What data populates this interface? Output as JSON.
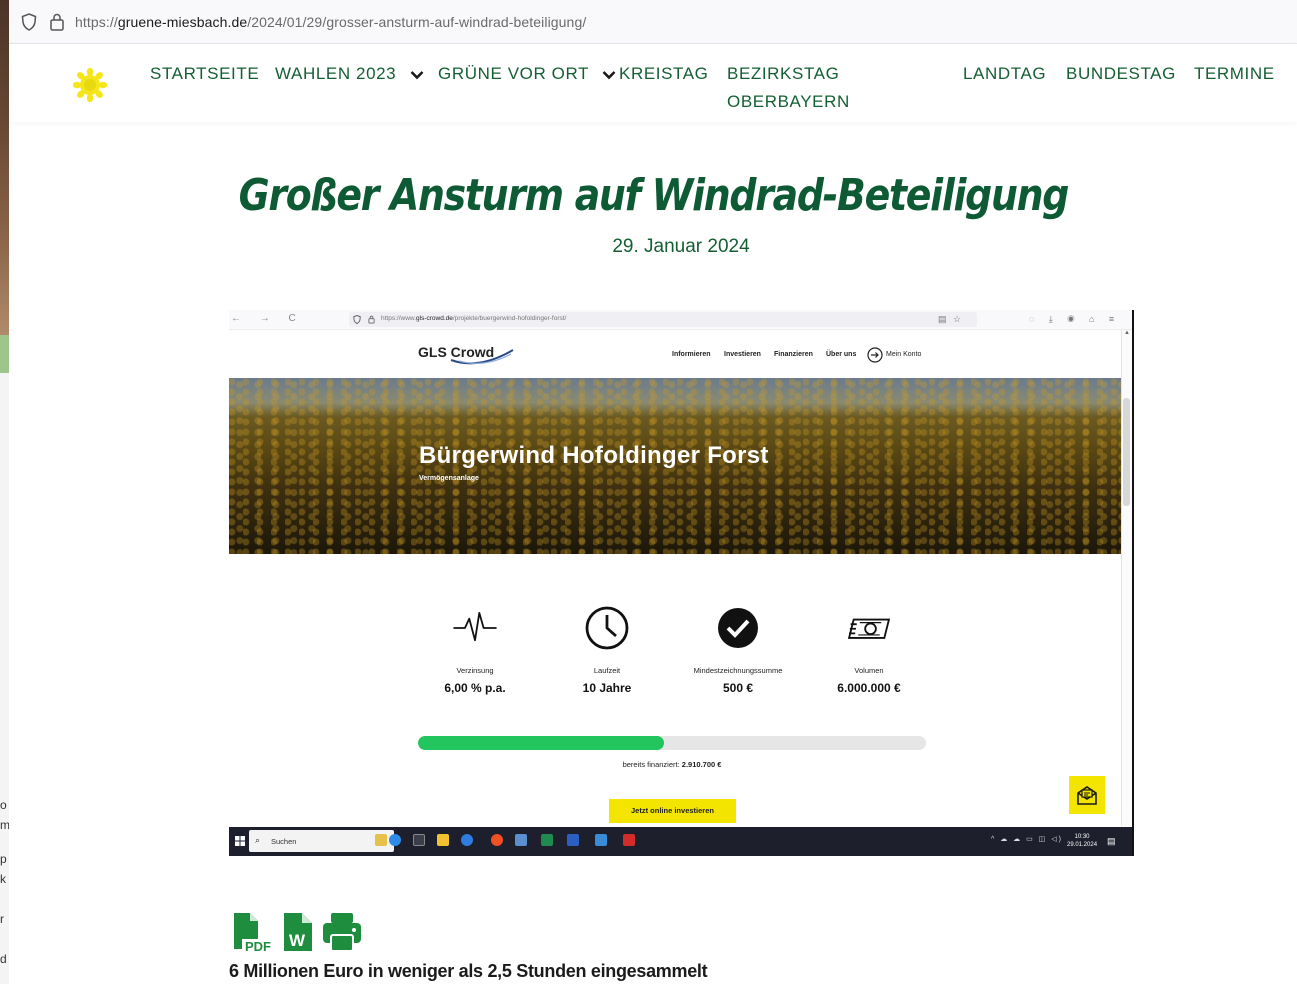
{
  "browser": {
    "url_prefix": "https://",
    "url_domain": "gruene-miesbach.de",
    "url_path": "/2024/01/29/grosser-ansturm-auf-windrad-beteiligung/"
  },
  "nav": {
    "items": [
      {
        "label": "STARTSEITE"
      },
      {
        "label": "WAHLEN 2023"
      },
      {
        "label": "GRÜNE VOR ORT"
      },
      {
        "label": "KREISTAG"
      },
      {
        "label": "BEZIRKSTAG"
      },
      {
        "label": "OBERBAYERN"
      },
      {
        "label": "LANDTAG"
      },
      {
        "label": "BUNDESTAG"
      },
      {
        "label": "TERMINE"
      }
    ]
  },
  "article": {
    "title": "Großer Ansturm auf Windrad-Beteiligung",
    "date": "29. Januar 2024",
    "subheading": "6 Millionen Euro in weniger als 2,5 Stunden eingesammelt"
  },
  "embedded": {
    "url_prefix": "https://www.",
    "url_domain": "gls-crowd.de",
    "url_path": "/projekte/buergerwind-hofoldinger-forst/",
    "logo": "GLS Crowd",
    "nav": [
      "Informieren",
      "Investieren",
      "Finanzieren",
      "Über uns",
      "Mein Konto"
    ],
    "hero_title": "Bürgerwind Hofoldinger Forst",
    "hero_subtitle": "Vermögensanlage",
    "stats": [
      {
        "label": "Verzinsung",
        "value": "6,00 % p.a.",
        "icon": "pulse-icon"
      },
      {
        "label": "Laufzeit",
        "value": "10 Jahre",
        "icon": "clock-icon"
      },
      {
        "label": "Mindestzeichnungssumme",
        "value": "500 €",
        "icon": "checkmark-icon"
      },
      {
        "label": "Volumen",
        "value": "6.000.000 €",
        "icon": "money-icon"
      }
    ],
    "progress_fraction": 0.485,
    "funded_label": "bereits finanziert:",
    "funded_value": "2.910.700 €",
    "invest_button": "Jetzt online investieren",
    "taskbar": {
      "search_placeholder": "Suchen",
      "time": "10:30",
      "date": "29.01.2024"
    }
  },
  "colors": {
    "green_primary": "#145f32",
    "green_title": "#0e5a34",
    "sunflower": "#f5e61a",
    "cta_yellow": "#f3e500",
    "progress_green": "#22c55e"
  },
  "sidebar_fragments": [
    "o",
    "m",
    "p",
    "k",
    "r",
    "d"
  ]
}
